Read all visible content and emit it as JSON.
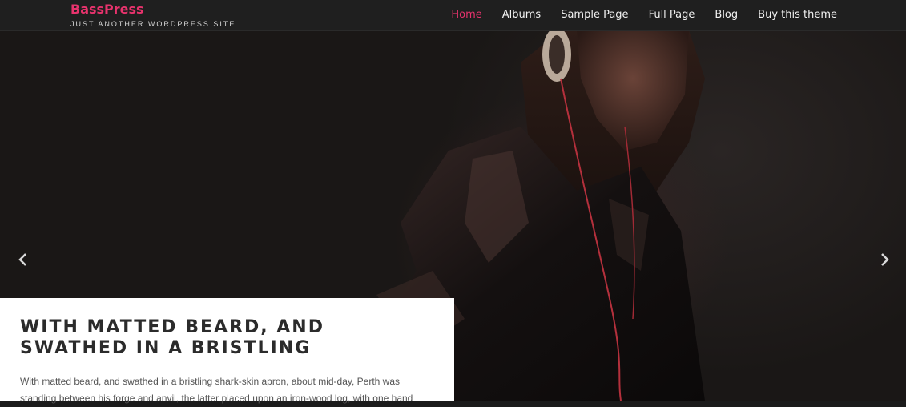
{
  "site": {
    "title": "BassPress",
    "tagline": "JUST ANOTHER WORDPRESS SITE"
  },
  "nav": {
    "items": [
      "Home",
      "Albums",
      "Sample Page",
      "Full Page",
      "Blog",
      "Buy this theme"
    ],
    "active": "Home"
  },
  "slider": {
    "prev_icon": "chevron-left-icon",
    "next_icon": "chevron-right-icon",
    "image": "woman-with-headphones-leather-jacket"
  },
  "slide": {
    "heading": "WITH MATTED BEARD, AND SWATHED IN A BRISTLING",
    "excerpt": "With matted beard, and swathed in a bristling shark-skin apron, about mid-day, Perth was standing between his forge and anvil, the latter placed upon an iron-wood log, with one hand"
  },
  "colors": {
    "accent": "#e8336d",
    "header_bg": "#1f1f1f",
    "card_bg": "#ffffff"
  }
}
